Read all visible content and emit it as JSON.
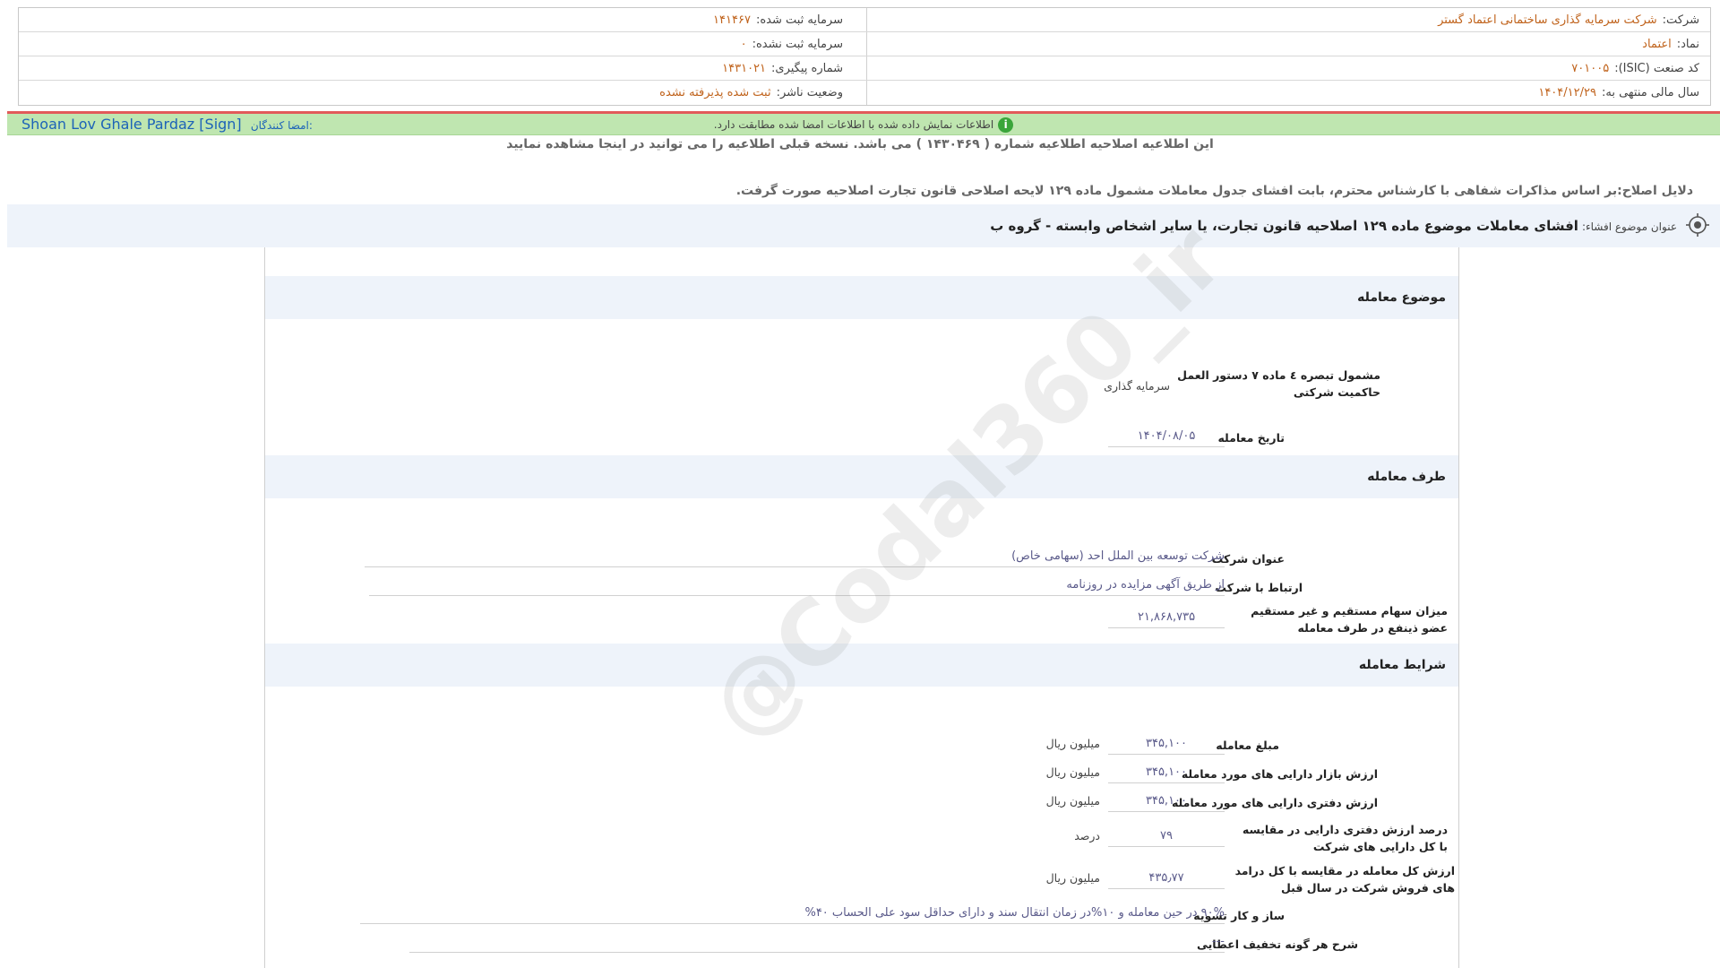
{
  "company": {
    "label": "شرکت:",
    "value": "شرکت سرمایه گذاری ساختمانی اعتماد گستر"
  },
  "registered_capital": {
    "label": "سرمایه ثبت شده:",
    "value": "۱۴۱۴۶۷"
  },
  "symbol": {
    "label": "نماد:",
    "value": "اعتماد"
  },
  "unregistered_capital": {
    "label": "سرمایه ثبت نشده:",
    "value": "۰"
  },
  "isic": {
    "label": "کد صنعت (ISIC):",
    "value": "۷۰۱۰۰۵"
  },
  "tracking_number": {
    "label": "شماره پیگیری:",
    "value": "۱۴۳۱۰۲۱"
  },
  "fiscal_year": {
    "label": "سال مالی منتهی به:",
    "value": "۱۴۰۴/۱۲/۲۹"
  },
  "publisher_status": {
    "label": "وضعیت ناشر:",
    "value": "ثبت شده پذیرفته نشده"
  },
  "signature_bar": {
    "message": "اطلاعات نمایش داده شده با اطلاعات امضا شده مطابقت دارد.",
    "info_icon": "i",
    "signers_label": "امضا کنندگان:",
    "signer_name": "Shoan Lov Ghale Pardaz [Sign]"
  },
  "notice": "این اطلاعیه اصلاحیه اطلاعیه شماره ( ۱۴۳۰۴۶۹ ) می باشد. نسخه قبلی اطلاعیه را می توانید در اینجا مشاهده نمایید",
  "correction_reason": "دلایل اصلاح:بر اساس مذاکرات شفاهی با کارشناس محترم، بابت افشای جدول معاملات مشمول ماده ۱۲۹ لایحه اصلاحی قانون تجارت اصلاحیه صورت گرفت.",
  "subject": {
    "label": "عنوان موضوع افشاء:",
    "title": "افشای معاملات موضوع ماده ۱۲۹ اصلاحیه قانون تجارت، یا سایر اشخاص وابسته - گروه ب"
  },
  "sections": {
    "transaction_subject": {
      "title": "موضوع معامله",
      "governance_label": "مشمول تبصره ٤ ماده ٧ دستور العمل حاکمیت شرکتی",
      "governance_value": "سرمایه گذاری",
      "date_label": "تاریخ معامله",
      "date_value": "۱۴۰۴/۰۸/۰۵"
    },
    "counterparty": {
      "title": "طرف معامله",
      "company_label": "عنوان شرکت",
      "company_value": "شرکت توسعه بین الملل احد (سهامی خاص)",
      "relation_label": "ارتباط با شرکت",
      "relation_value": "از طریق آگهی مزایده در روزنامه",
      "shares_label": "میزان سهام مستقیم و غیر مستقیم عضو ذینفع در طرف معامله",
      "shares_value": "۲۱,۸۶۸,۷۳۵"
    },
    "terms": {
      "title": "شرایط معامله",
      "amount_label": "مبلغ معامله",
      "amount_value": "۳۴۵,۱۰۰",
      "amount_unit": "میلیون ریال",
      "market_label": "ارزش بازار دارایی های مورد معامله",
      "market_value": "۳۴۵,۱۰۰",
      "market_unit": "میلیون ریال",
      "book_label": "ارزش دفتری دارایی های مورد معامله",
      "book_value": "۳۴۵,۱۰۰",
      "book_unit": "میلیون ریال",
      "book_pct_label": "درصد ارزش دفتری دارایی در مقایسه با کل دارایی های شرکت",
      "book_pct_value": "۷۹",
      "book_pct_unit": "درصد",
      "total_label": "ارزش کل معامله در مقایسه با کل درامد های فروش شرکت در سال قبل",
      "total_value": "۴۳۵٫۷۷",
      "total_unit": "میلیون ریال",
      "settlement_label": "ساز و کار تسویه",
      "settlement_value": "۹۰% در حین معامله و ۱۰%در زمان انتقال سند و دارای حداقل سود علی الحساب ۴۰%",
      "discount_label": "شرح هر گونه تخفیف اعطایی",
      "discount_value": "---"
    }
  },
  "watermark": "@Codal360_ir"
}
